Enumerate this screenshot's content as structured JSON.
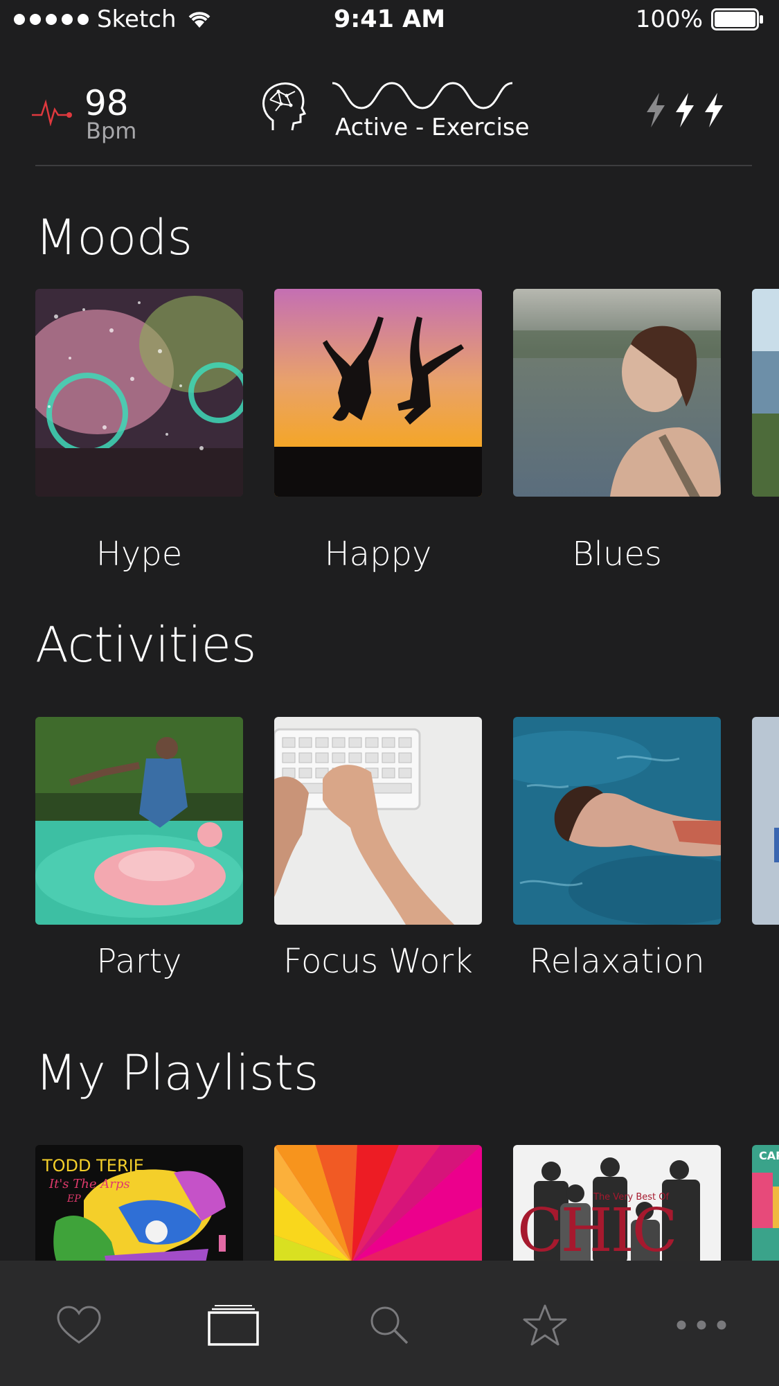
{
  "status": {
    "carrier": "Sketch",
    "time": "9:41 AM",
    "battery": "100%"
  },
  "bio": {
    "bpm_value": "98",
    "bpm_unit": "Bpm",
    "activity": "Active - Exercise"
  },
  "sections": {
    "moods": {
      "title": "Moods",
      "items": [
        "Hype",
        "Happy",
        "Blues"
      ]
    },
    "activities": {
      "title": "Activities",
      "items": [
        "Party",
        "Focus Work",
        "Relaxation"
      ]
    },
    "playlists": {
      "title": "My Playlists",
      "album_text": {
        "todd": "TODD TERJE",
        "todd_sub": "It's The Arps",
        "todd_ep": "EP",
        "chic_top": "The Very Best Of",
        "chic": "CHIC",
        "carib": "CARI"
      }
    }
  },
  "tabs": [
    "heart-icon",
    "library-icon",
    "search-icon",
    "star-icon",
    "more-icon"
  ],
  "colors": {
    "background": "#1e1e1f",
    "accent_heart": "#e0393e",
    "tabbar": "#2a2a2b"
  }
}
